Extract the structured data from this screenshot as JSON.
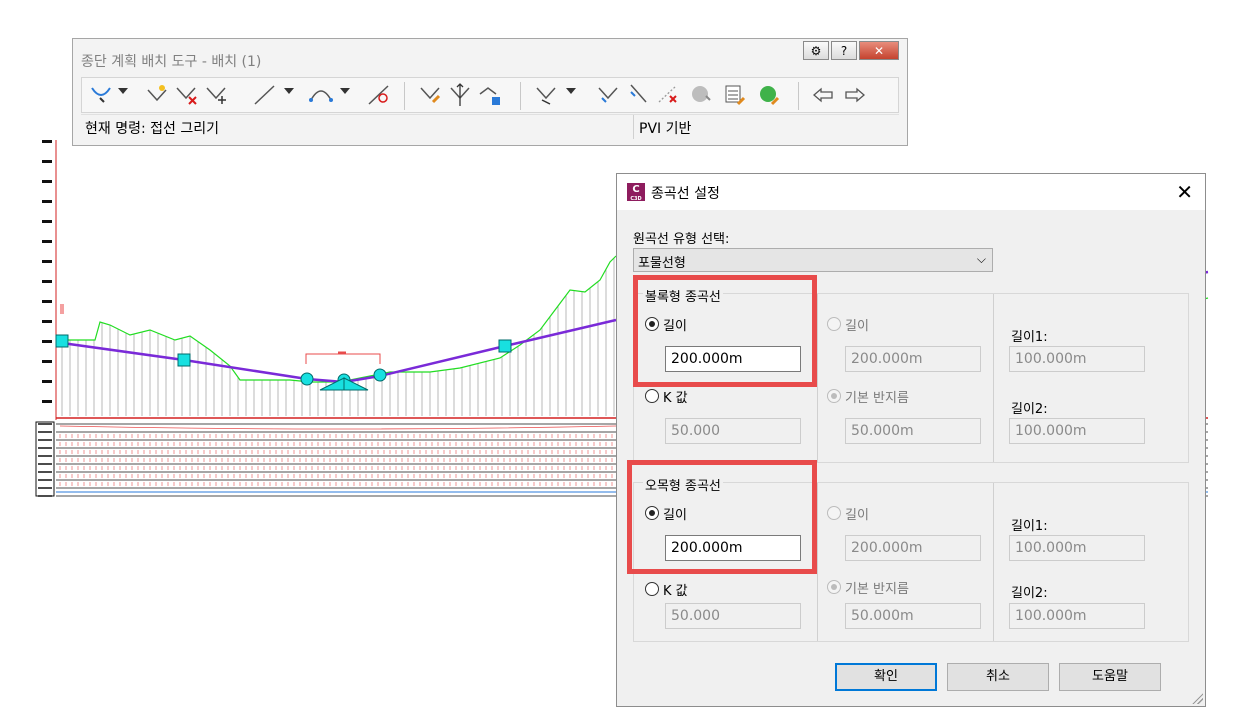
{
  "toolbar": {
    "title": "종단 계획 배치 도구 - 배치 (1)",
    "help_label": "?",
    "close_label": "✕",
    "current_command": "현재 명령: 접선 그리기",
    "pvi_mode": "PVI 기반",
    "icons": [
      "draw-tangents-icon",
      "insert-pvi-icon",
      "delete-pvi-icon",
      "move-pvi-icon",
      "tangent-icon",
      "curve-icon",
      "free-curve-icon",
      "insert-pvis-tabular-icon",
      "raise-lower-pvi-icon",
      "copy-pvi-icon",
      "entity-icon",
      "delete-entity-icon",
      "sub-entity-editor-icon",
      "grid-view-icon",
      "profile-grid-view-icon",
      "undo-icon",
      "redo-icon"
    ]
  },
  "dialog": {
    "title": "종곡선 설정",
    "app_icon": "C",
    "app_icon_sub": "C3D",
    "close_label": "✕",
    "curve_type_label": "원곡선 유형 선택:",
    "curve_type_value": "포물선형",
    "crest": {
      "title": "볼록형 종곡선",
      "length_label": "길이",
      "length_value": "200.000m",
      "k_label": "K 값",
      "k_value": "50.000",
      "mid_length_label": "길이",
      "mid_length_value": "200.000m",
      "mid_radius_label": "기본 반지름",
      "mid_radius_value": "50.000m",
      "length1_label": "길이1:",
      "length1_value": "100.000m",
      "length2_label": "길이2:",
      "length2_value": "100.000m"
    },
    "sag": {
      "title": "오목형 종곡선",
      "length_label": "길이",
      "length_value": "200.000m",
      "k_label": "K 값",
      "k_value": "50.000",
      "mid_length_label": "길이",
      "mid_length_value": "200.000m",
      "mid_radius_label": "기본 반지름",
      "mid_radius_value": "50.000m",
      "length1_label": "길이1:",
      "length1_value": "100.000m",
      "length2_label": "길이2:",
      "length2_value": "100.000m"
    },
    "buttons": {
      "ok": "확인",
      "cancel": "취소",
      "help": "도움말"
    }
  },
  "colors": {
    "ground_line": "#22dd22",
    "design_line": "#7a2ad8",
    "pvi_marker": "#18e0e0",
    "highlight": "#e84b4b",
    "primary_button_border": "#0078d7"
  }
}
